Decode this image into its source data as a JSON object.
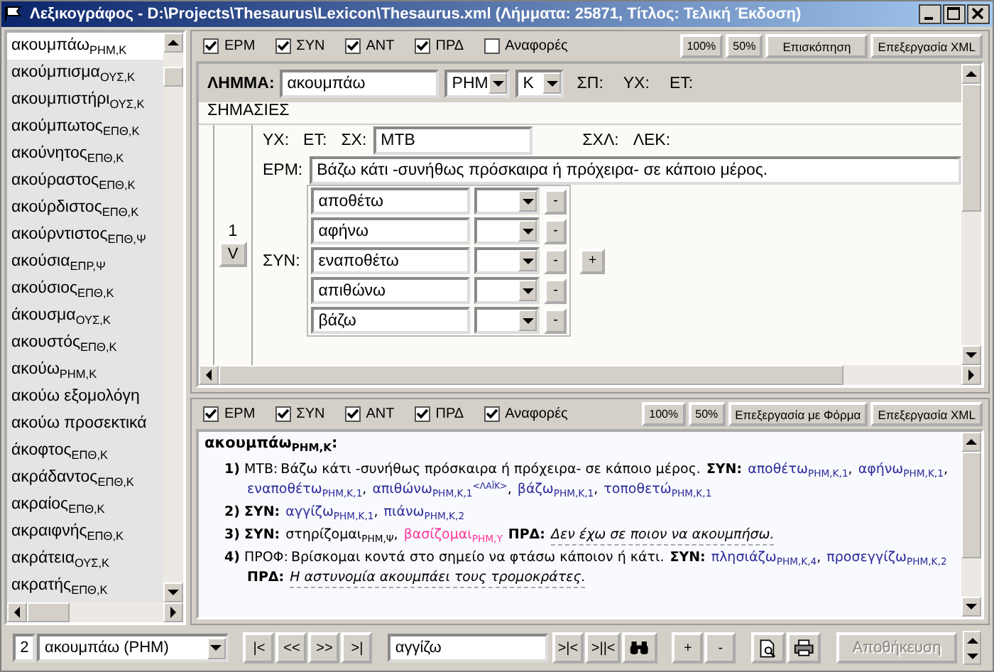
{
  "window": {
    "title": "Λεξικογράφος - D:\\Projects\\Thesaurus\\Lexicon\\Thesaurus.xml (Λήμματα: 25871, Τίτλος: Τελική Έκδοση)"
  },
  "entries": [
    {
      "word": "ακουμπάω$_{ΡΗΜ,Κ}$",
      "selected": true
    },
    {
      "word": "ακούμπισμα$_{ΟΥΣ,Κ}$",
      "selected": false
    },
    {
      "word": "ακουμπιστήρι$_{ΟΥΣ,Κ}$",
      "selected": false
    },
    {
      "word": "ακούμπωτος$_{ΕΠΘ,Κ}$",
      "selected": false
    },
    {
      "word": "ακούνητος$_{ΕΠΘ,Κ}$",
      "selected": false
    },
    {
      "word": "ακούραστος$_{ΕΠΘ,Κ}$",
      "selected": false
    },
    {
      "word": "ακούρδιστος$_{ΕΠΘ,Κ}$",
      "selected": false
    },
    {
      "word": "ακούρντιστος$_{ΕΠΘ,Ψ}$",
      "selected": false
    },
    {
      "word": "ακούσια$_{ΕΠΡ,Ψ}$",
      "selected": false
    },
    {
      "word": "ακούσιος$_{ΕΠΘ,Κ}$",
      "selected": false
    },
    {
      "word": "άκουσμα$_{ΟΥΣ,Κ}$",
      "selected": false
    },
    {
      "word": "ακουστός$_{ΕΠΘ,Κ}$",
      "selected": false
    },
    {
      "word": "ακούω$_{ΡΗΜ,Κ}$",
      "selected": false
    },
    {
      "word": "ακούω εξομολόγη",
      "selected": false
    },
    {
      "word": "ακούω προσεκτικά",
      "selected": false
    },
    {
      "word": "άκοφτος$_{ΕΠΘ,Κ}$",
      "selected": false
    },
    {
      "word": "ακράδαντος$_{ΕΠΘ,Κ}$",
      "selected": false
    },
    {
      "word": "ακραίος$_{ΕΠΘ,Κ}$",
      "selected": false
    },
    {
      "word": "ακραιφνής$_{ΕΠΘ,Κ}$",
      "selected": false
    },
    {
      "word": "ακράτεια$_{ΟΥΣ,Κ}$",
      "selected": false
    },
    {
      "word": "ακρατής$_{ΕΠΘ,Κ}$",
      "selected": false
    }
  ],
  "editor": {
    "filters": [
      {
        "label": "ΕΡΜ",
        "checked": true
      },
      {
        "label": "ΣΥΝ",
        "checked": true
      },
      {
        "label": "ΑΝΤ",
        "checked": true
      },
      {
        "label": "ΠΡΔ",
        "checked": true
      },
      {
        "label": "Αναφορές",
        "checked": false
      }
    ],
    "zoom_buttons": [
      "100%",
      "50%"
    ],
    "action_buttons": [
      "Επισκόπηση",
      "Επεξεργασία XML"
    ],
    "lemma": {
      "label": "ΛΗΜΜΑ:",
      "value": "ακουμπάω",
      "pos": "ΡΗΜ",
      "register": "Κ",
      "fields": [
        "ΣΠ:",
        "ΥΧ:",
        "ΕΤ:"
      ]
    },
    "section_title": "ΣΗΜΑΣΙΕΣ",
    "sense": {
      "number": "1",
      "move_button": "V",
      "fields": [
        "ΥΧ:",
        "ΕΤ:"
      ],
      "sx_label": "ΣΧ:",
      "sx_value": "ΜΤΒ",
      "more_fields": [
        "ΣΧΛ:",
        "ΛΕΚ:"
      ],
      "erm_label": "ΕΡΜ:",
      "erm_value": "Βάζω κάτι -συνήθως πρόσκαιρα ή πρόχειρα- σε κάποιο μέρος.",
      "syn_label": "ΣΥΝ:",
      "add_button": "+",
      "synonyms": [
        {
          "word": "αποθέτω",
          "remove": "-"
        },
        {
          "word": "αφήνω",
          "remove": "-"
        },
        {
          "word": "εναποθέτω",
          "remove": "-"
        },
        {
          "word": "απιθώνω",
          "remove": "-"
        },
        {
          "word": "βάζω",
          "remove": "-"
        }
      ]
    }
  },
  "preview": {
    "filters": [
      {
        "label": "ΕΡΜ",
        "checked": true
      },
      {
        "label": "ΣΥΝ",
        "checked": true
      },
      {
        "label": "ΑΝΤ",
        "checked": true
      },
      {
        "label": "ΠΡΔ",
        "checked": true
      },
      {
        "label": "Αναφορές",
        "checked": true
      }
    ],
    "zoom_buttons": [
      "100%",
      "50%"
    ],
    "action_buttons": [
      "Επεξεργασία με Φόρμα",
      "Επεξεργασία XML"
    ],
    "heading": "ακουμπάω$_{ΡΗΜ,Κ}$:",
    "senses": [
      {
        "number": "1)",
        "parts": [
          {
            "kind": "tag",
            "text": "ΜΤΒ:"
          },
          {
            "kind": "text",
            "text": "Βάζω κάτι -συνήθως πρόσκαιρα ή πρόχειρα- σε κάποιο μέρος."
          },
          {
            "kind": "label",
            "text": "ΣΥΝ:"
          },
          {
            "kind": "link",
            "text": "αποθέτω$_{ΡΗΜ,Κ,1}$"
          },
          {
            "kind": "punct",
            "text": ","
          },
          {
            "kind": "link",
            "text": "αφήνω$_{ΡΗΜ,Κ,1}$"
          },
          {
            "kind": "punct",
            "text": ","
          },
          {
            "kind": "link",
            "text": "εναποθέτω$_{ΡΗΜ,Κ,1}$"
          },
          {
            "kind": "punct",
            "text": ","
          },
          {
            "kind": "link",
            "text": "απιθώνω$_{ΡΗΜ,Κ,1}$$^{<ΛΑΪΚ>}$"
          },
          {
            "kind": "punct",
            "text": ","
          },
          {
            "kind": "link",
            "text": "βάζω$_{ΡΗΜ,Κ,1}$"
          },
          {
            "kind": "punct",
            "text": ","
          },
          {
            "kind": "link",
            "text": "τοποθετώ$_{ΡΗΜ,Κ,1}$"
          }
        ]
      },
      {
        "number": "2)",
        "parts": [
          {
            "kind": "label",
            "text": "ΣΥΝ:"
          },
          {
            "kind": "link",
            "text": "αγγίζω$_{ΡΗΜ,Κ,1}$"
          },
          {
            "kind": "punct",
            "text": ","
          },
          {
            "kind": "link",
            "text": "πιάνω$_{ΡΗΜ,Κ,2}$"
          }
        ]
      },
      {
        "number": "3)",
        "parts": [
          {
            "kind": "label",
            "text": "ΣΥΝ:"
          },
          {
            "kind": "text",
            "text": "στηρίζομαι$_{ΡΗΜ,Ψ}$,"
          },
          {
            "kind": "marked_link",
            "text": "βασίζομαι$_{ΡΗΜ,Υ}$"
          },
          {
            "kind": "label",
            "text": "ΠΡΔ:"
          },
          {
            "kind": "example",
            "text": "Δεν έχω σε ποιον να ακουμπήσω."
          }
        ]
      },
      {
        "number": "4)",
        "parts": [
          {
            "kind": "tag",
            "text": "ΠΡΟΦ:"
          },
          {
            "kind": "text",
            "text": "Βρίσκομαι κοντά στο σημείο να φτάσω κάποιον ή κάτι."
          },
          {
            "kind": "label",
            "text": "ΣΥΝ:"
          },
          {
            "kind": "link",
            "text": "πλησιάζω$_{ΡΗΜ,Κ,4}$"
          },
          {
            "kind": "punct",
            "text": ","
          },
          {
            "kind": "link",
            "text": "προσεγγίζω$_{ΡΗΜ,Κ,2}$"
          },
          {
            "kind": "label",
            "text": "ΠΡΔ:"
          },
          {
            "kind": "example",
            "text": "Η αστυνομία ακουμπάει τους τρομοκράτες."
          }
        ]
      }
    ]
  },
  "toolbar": {
    "record_number": "2",
    "record": "ακουμπάω (ΡΗΜ)",
    "nav_buttons": [
      "|<",
      "<<",
      ">>",
      ">|"
    ],
    "search_value": "αγγίζω",
    "search_buttons": [
      ">|<",
      ">||<"
    ],
    "edit_buttons": [
      "+",
      "-"
    ],
    "save_button": {
      "label": "Αποθήκευση",
      "disabled": true
    }
  }
}
